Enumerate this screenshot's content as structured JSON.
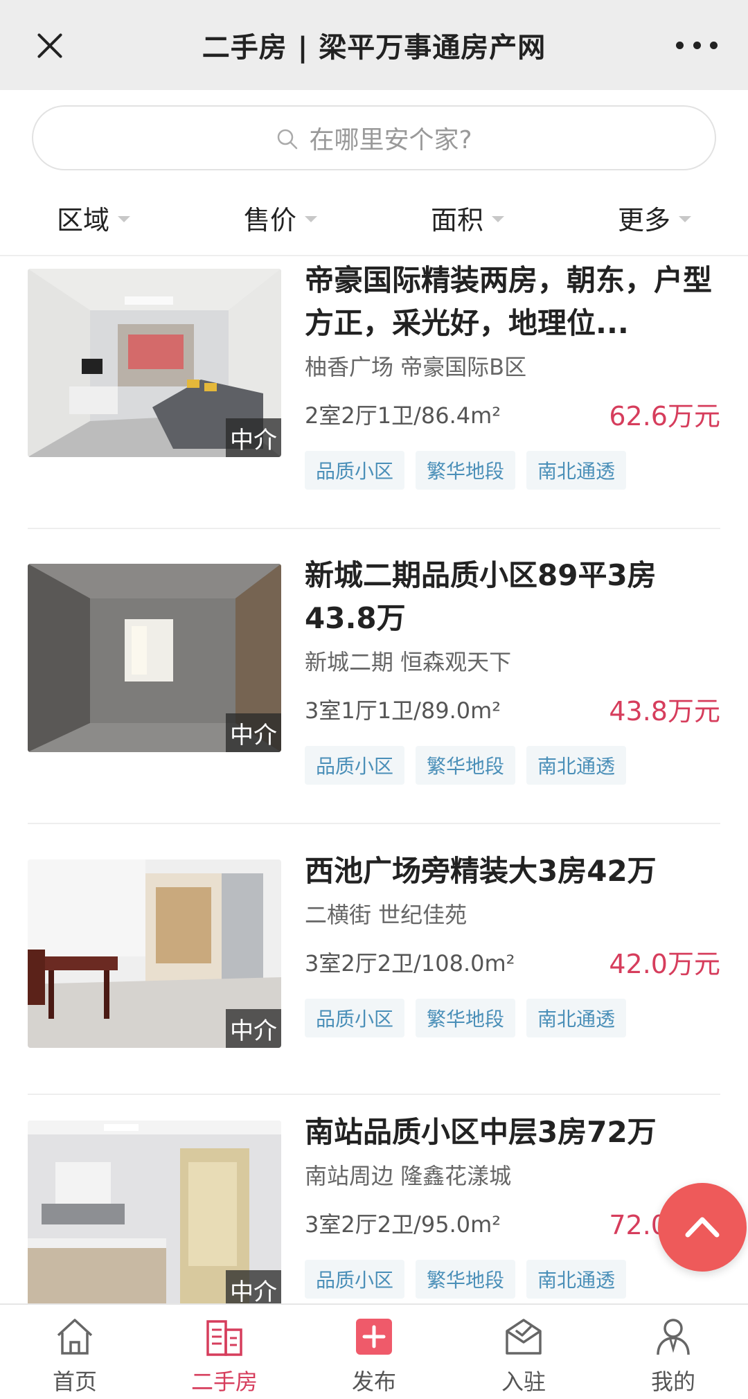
{
  "header": {
    "title": "二手房 | 梁平万事通房产网"
  },
  "search": {
    "placeholder": "在哪里安个家?"
  },
  "filters": [
    {
      "label": "区域"
    },
    {
      "label": "售价"
    },
    {
      "label": "面积"
    },
    {
      "label": "更多"
    }
  ],
  "listings": [
    {
      "title": "帝豪国际精装两房，朝东，户型方正，采光好，地理位...",
      "area": "柚香广场 帝豪国际B区",
      "spec": "2室2厅1卫/86.4m²",
      "price": "62.6万元",
      "badge": "中介",
      "tags": [
        "品质小区",
        "繁华地段",
        "南北通透"
      ]
    },
    {
      "title": "新城二期品质小区89平3房43.8万",
      "area": "新城二期 恒森观天下",
      "spec": "3室1厅1卫/89.0m²",
      "price": "43.8万元",
      "badge": "中介",
      "tags": [
        "品质小区",
        "繁华地段",
        "南北通透"
      ]
    },
    {
      "title": "西池广场旁精装大3房42万",
      "area": "二横街 世纪佳苑",
      "spec": "3室2厅2卫/108.0m²",
      "price": "42.0万元",
      "badge": "中介",
      "tags": [
        "品质小区",
        "繁华地段",
        "南北通透"
      ]
    },
    {
      "title": "南站品质小区中层3房72万",
      "area": "南站周边 隆鑫花漾城",
      "spec": "3室2厅2卫/95.0m²",
      "price": "72.0万元",
      "badge": "中介",
      "tags": [
        "品质小区",
        "繁华地段",
        "南北通透"
      ]
    }
  ],
  "bottom_nav": [
    {
      "label": "首页",
      "icon": "home-icon",
      "active": false
    },
    {
      "label": "二手房",
      "icon": "building-icon",
      "active": true
    },
    {
      "label": "发布",
      "icon": "plus-icon",
      "active": false
    },
    {
      "label": "入驻",
      "icon": "mail-check-icon",
      "active": false
    },
    {
      "label": "我的",
      "icon": "user-icon",
      "active": false
    }
  ],
  "colors": {
    "accent": "#d63d5c",
    "tag_text": "#4a8fb8",
    "float_button": "#ee5a5a"
  }
}
